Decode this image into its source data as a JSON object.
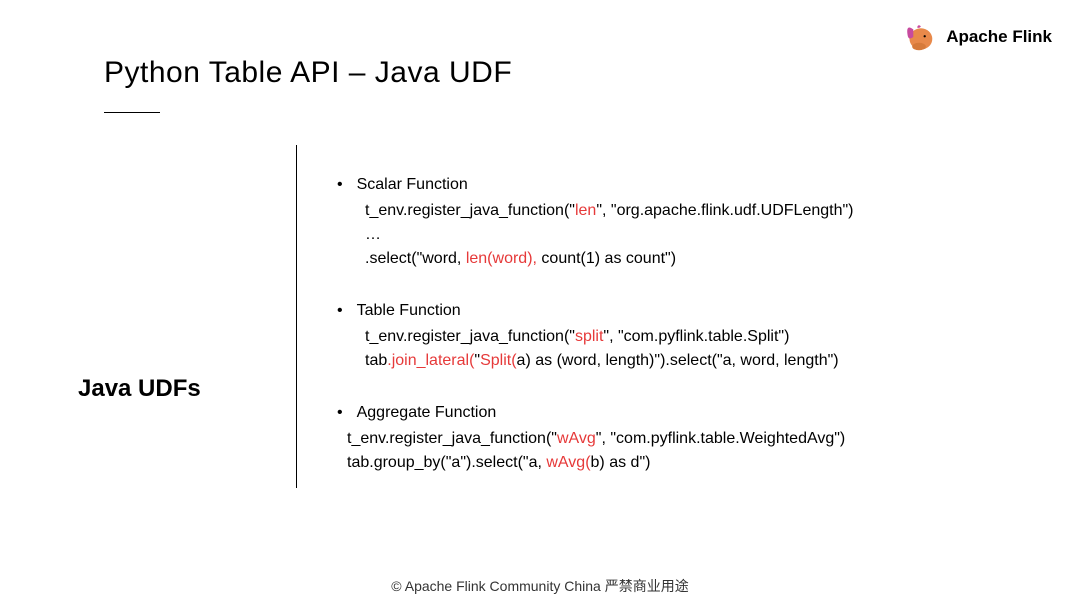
{
  "header": {
    "logo_text": "Apache Flink"
  },
  "title": "Python Table API – Java UDF",
  "left_label": "Java UDFs",
  "sections": {
    "scalar": {
      "heading": "Scalar Function",
      "line1a": "t_env.register_java_function(\"",
      "line1b": "len",
      "line1c": "\", \"org.apache.flink.udf.UDFLength\")",
      "ellipsis": "…",
      "line2a": ".select(\"word, ",
      "line2b": "len(word),",
      "line2c": " count(1) as count\")"
    },
    "table": {
      "heading": "Table Function",
      "line1a": "t_env.register_java_function(\"",
      "line1b": "split",
      "line1c": "\", \"com.pyflink.table.Split\")",
      "line2a": "tab",
      "line2b": ".join_lateral(",
      "line2c": "\"",
      "line2d": "Split(",
      "line2e": "a) as (word, length)\").select(\"a, word, length\")"
    },
    "aggregate": {
      "heading": "Aggregate Function",
      "line1a": "t_env.register_java_function(\"",
      "line1b": "wAvg",
      "line1c": "\", \"com.pyflink.table.WeightedAvg\")",
      "line2a": "tab.group_by(\"a\").select(\"a, ",
      "line2b": "wAvg(",
      "line2c": "b) as d\")"
    }
  },
  "footer": "© Apache Flink Community China  严禁商业用途"
}
